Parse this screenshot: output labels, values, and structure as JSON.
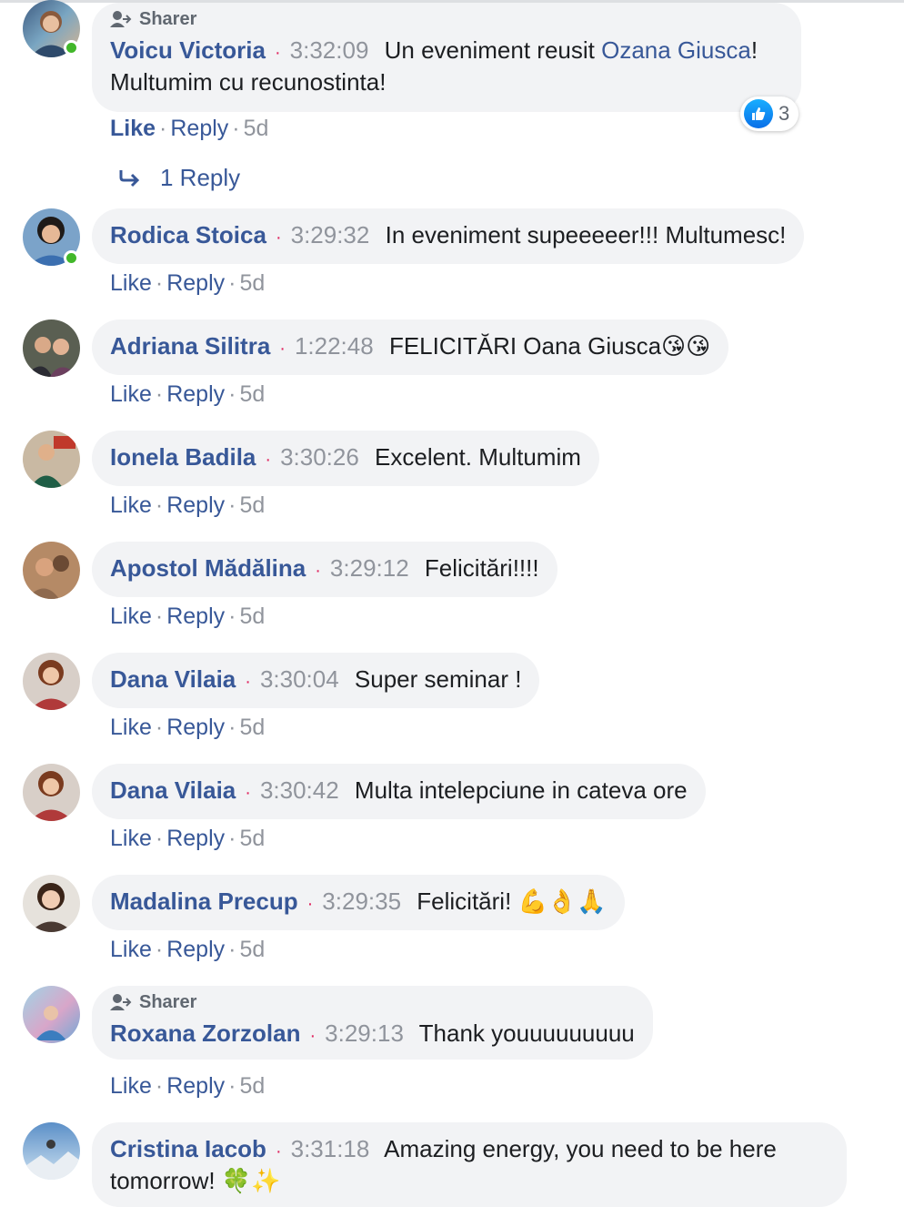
{
  "sharer_label": "Sharer",
  "reply_count_label": "1 Reply",
  "comments": [
    {
      "author": "Voicu Victoria",
      "time": "3:32:09",
      "text_before": "Un eveniment reusit",
      "mention": "Ozana Giusca",
      "text_after": "!",
      "line2": "Multumim cu recunostinta!",
      "like": "Like",
      "reply": "Reply",
      "age": "5d",
      "reaction_count": "3"
    },
    {
      "author": "Rodica Stoica",
      "time": "3:29:32",
      "text": "In eveniment supeeeeer!!! Multumesc!",
      "like": "Like",
      "reply": "Reply",
      "age": "5d"
    },
    {
      "author": "Adriana Silitra",
      "time": "1:22:48",
      "text": "FELICITĂRI Oana Giusca",
      "emoji": "😘😘",
      "like": "Like",
      "reply": "Reply",
      "age": "5d"
    },
    {
      "author": "Ionela Badila",
      "time": "3:30:26",
      "text": "Excelent. Multumim",
      "like": "Like",
      "reply": "Reply",
      "age": "5d"
    },
    {
      "author": "Apostol Mădălina",
      "time": "3:29:12",
      "text": "Felicitări!!!!",
      "like": "Like",
      "reply": "Reply",
      "age": "5d"
    },
    {
      "author": "Dana Vilaia",
      "time": "3:30:04",
      "text": "Super seminar !",
      "like": "Like",
      "reply": "Reply",
      "age": "5d"
    },
    {
      "author": "Dana Vilaia",
      "time": "3:30:42",
      "text": "Multa intelepciune in cateva ore",
      "like": "Like",
      "reply": "Reply",
      "age": "5d"
    },
    {
      "author": "Madalina Precup",
      "time": "3:29:35",
      "text": "Felicitări!",
      "emoji": "💪👌🙏",
      "like": "Like",
      "reply": "Reply",
      "age": "5d"
    },
    {
      "author": "Roxana Zorzolan",
      "time": "3:29:13",
      "text": "Thank youuuuuuuuu",
      "like": "Like",
      "reply": "Reply",
      "age": "5d"
    },
    {
      "author": "Cristina Iacob",
      "time": "3:31:18",
      "text": "Amazing energy, you need to be here",
      "line2": "tomorrow!",
      "emoji": "🍀✨"
    }
  ],
  "colors": {
    "link": "#385898",
    "bubble": "#f2f3f5",
    "meta": "#90949c",
    "online": "#42b72a",
    "like_blue": "#1877f2"
  }
}
